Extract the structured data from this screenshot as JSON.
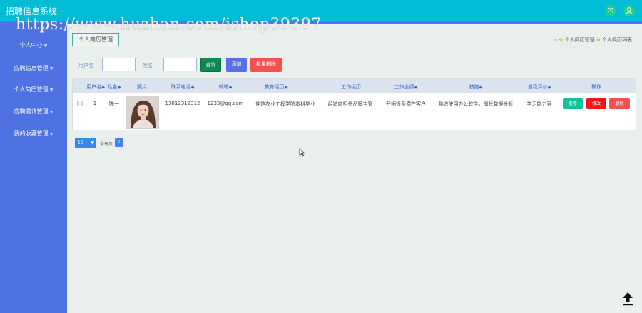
{
  "header": {
    "app_title": "招聘信息系统",
    "watermark": "https://www.huzhan.com/ishop39397",
    "icons": [
      "shrink-icon",
      "user-icon"
    ],
    "colors": {
      "bar": "#00bcd4",
      "accent": "#4a78ee",
      "icon_bg": "#1fd08a"
    }
  },
  "sidebar": {
    "items": [
      {
        "label": "个人中心"
      },
      {
        "label": "应聘信息管理"
      },
      {
        "label": "个人简历管理"
      },
      {
        "label": "应聘邀请管理"
      },
      {
        "label": "我的收藏管理"
      }
    ],
    "color": "#4f72e2"
  },
  "breadcrumb": {
    "tab": "个人简历管理",
    "path": [
      "个人简历管理",
      "个人简历列表"
    ]
  },
  "search": {
    "username_label": "用户名",
    "name_label": "姓名",
    "username_value": "",
    "name_value": "",
    "query_label": "查询",
    "add_label": "添加",
    "batch_delete_label": "批量删除"
  },
  "table": {
    "columns": [
      "用户名",
      "姓名",
      "照片",
      "联系电话",
      "邮箱",
      "教育经历",
      "工作经历",
      "工作业绩",
      "技能",
      "自我评价",
      "操作"
    ],
    "rows": [
      {
        "username": "1",
        "name": "陈一",
        "phone": "13812312312",
        "email": "1233@qq.com",
        "education": "仲恺农业工程学院本科毕业",
        "work_experience": "经销商担任品牌主管",
        "achievements": "开拓很多潜在客户",
        "skills": "熟练使用办公软件，擅长数据分析",
        "self_evaluation": "学习能力强",
        "actions": {
          "view": "查看",
          "edit": "修改",
          "delete": "删除"
        }
      }
    ]
  },
  "pagination": {
    "page_size": "10",
    "per_page_label": "条每页",
    "current_page": "1"
  }
}
